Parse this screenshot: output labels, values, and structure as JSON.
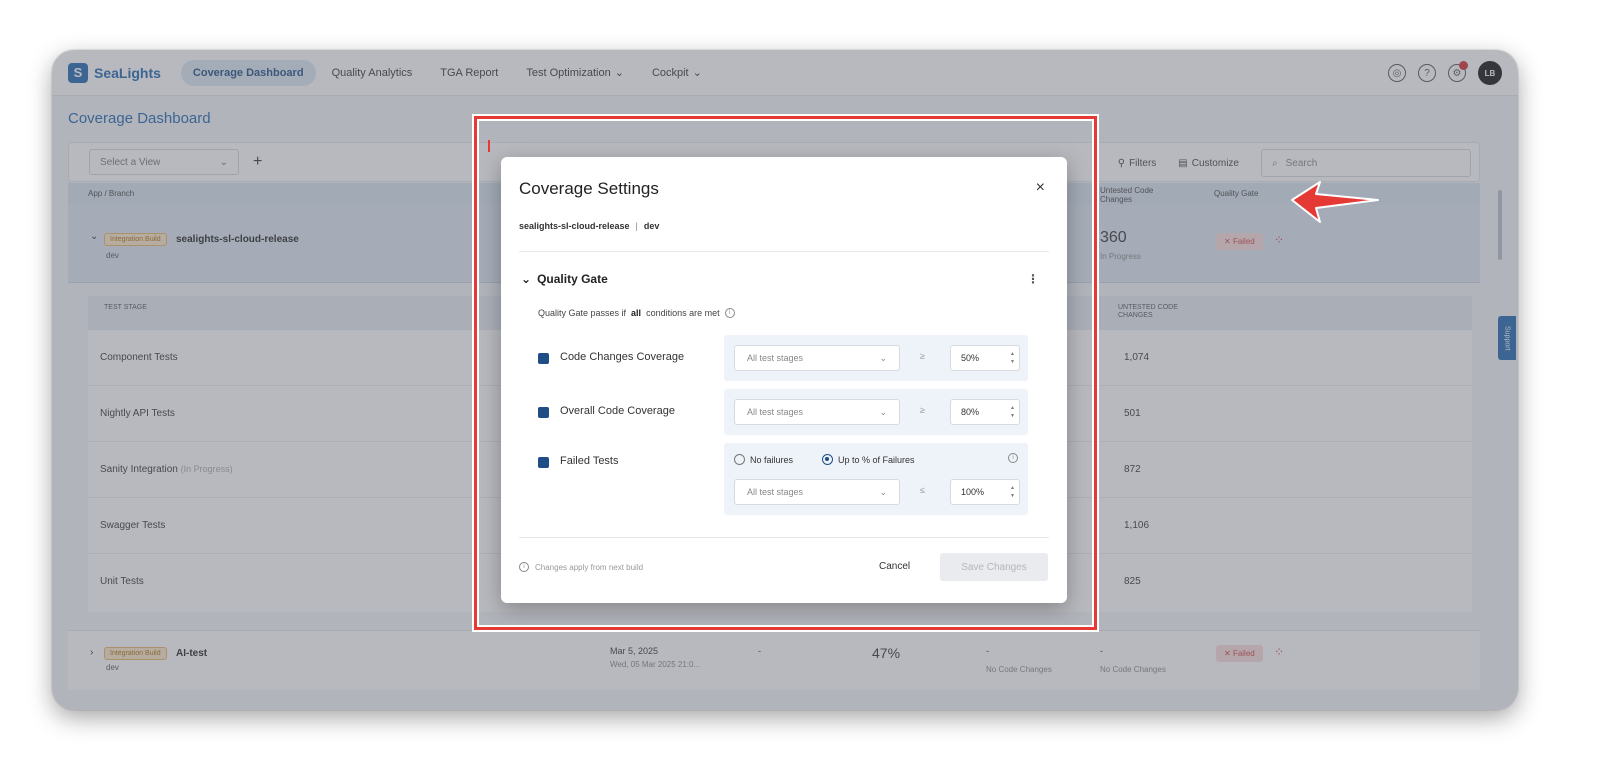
{
  "brand": {
    "name": "SeaLights",
    "accent": "#1f66b1"
  },
  "nav": {
    "tabs": [
      {
        "label": "Coverage Dashboard",
        "active": true
      },
      {
        "label": "Quality Analytics"
      },
      {
        "label": "TGA Report"
      },
      {
        "label": "Test Optimization",
        "dropdown": true
      },
      {
        "label": "Cockpit",
        "dropdown": true
      }
    ],
    "icons": [
      "target-icon",
      "help-icon",
      "notifications-icon"
    ],
    "avatar_initials": "LB"
  },
  "page": {
    "title": "Coverage Dashboard"
  },
  "toolbar": {
    "select_view_placeholder": "Select a View",
    "add_label": "+",
    "filters_label": "Filters",
    "customize_label": "Customize",
    "search_placeholder": "Search"
  },
  "table": {
    "headers": {
      "app_branch": "App / Branch",
      "untested": "Untested Code Changes",
      "quality_gate": "Quality Gate"
    },
    "build1": {
      "tag": "Integration Build",
      "name": "sealights-sl-cloud-release",
      "branch": "dev",
      "untested_value": "360",
      "untested_sub": "In Progress",
      "gate_status": "Failed"
    },
    "stage_headers": {
      "stage": "TEST STAGE",
      "untested": "UNTESTED CODE CHANGES"
    },
    "stages": [
      {
        "name": "Component Tests",
        "note": "",
        "value": "1,074"
      },
      {
        "name": "Nightly API Tests",
        "note": "",
        "value": "501"
      },
      {
        "name": "Sanity Integration",
        "note": "(In Progress)",
        "value": "872"
      },
      {
        "name": "Swagger Tests",
        "note": "",
        "value": "1,106"
      },
      {
        "name": "Unit Tests",
        "note": "",
        "value": "825"
      }
    ],
    "build2": {
      "tag": "Integration Build",
      "name": "AI-test",
      "branch": "dev",
      "date_main": "Mar 5, 2025",
      "date_sub": "Wed, 05 Mar 2025 21:0...",
      "dash": "-",
      "coverage": "47%",
      "col1_dash": "-",
      "col1_sub": "No Code Changes",
      "col2_dash": "-",
      "col2_sub": "No Code Changes",
      "gate_status": "Failed"
    },
    "support_label": "Support"
  },
  "modal": {
    "title": "Coverage Settings",
    "close": "×",
    "app": "sealights-sl-cloud-release",
    "separator": "|",
    "branch": "dev",
    "section_title": "Quality Gate",
    "kebab": "⋮",
    "desc_prefix": "Quality Gate passes if",
    "desc_bold": "all",
    "desc_suffix": "conditions are met",
    "conditions": [
      {
        "label": "Code Changes Coverage",
        "stage": "All test stages",
        "op": "≥",
        "value": "50%"
      },
      {
        "label": "Overall Code Coverage",
        "stage": "All test stages",
        "op": "≥",
        "value": "80%"
      },
      {
        "label": "Failed Tests",
        "stage": "All test stages",
        "op": "≤",
        "value": "100%",
        "radio_none": "No failures",
        "radio_pct": "Up to % of Failures"
      }
    ],
    "footer_note": "Changes apply from next build",
    "cancel": "Cancel",
    "save": "Save Changes"
  },
  "colors": {
    "highlight": "#e53935",
    "failed": "#d04545"
  }
}
